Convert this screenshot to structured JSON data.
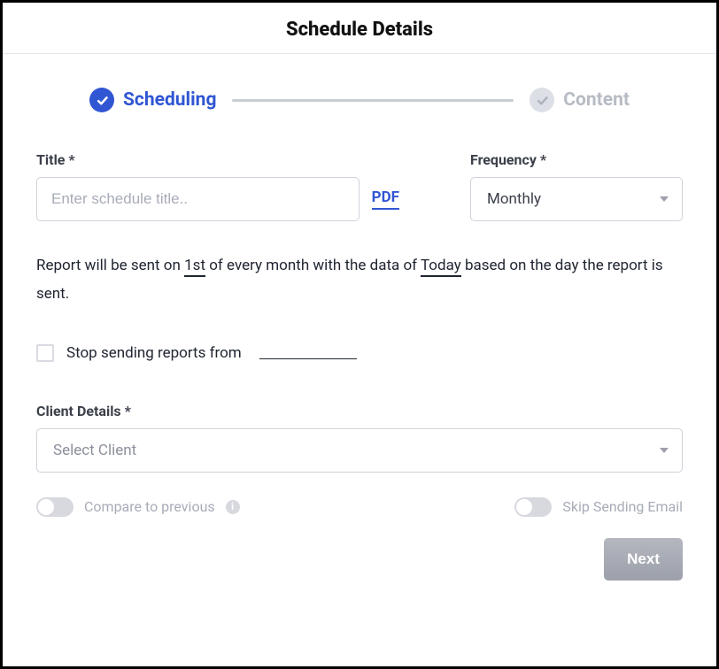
{
  "header": {
    "title": "Schedule Details"
  },
  "stepper": {
    "steps": [
      {
        "label": "Scheduling",
        "active": true
      },
      {
        "label": "Content",
        "active": false
      }
    ]
  },
  "form": {
    "title_label": "Title *",
    "title_placeholder": "Enter schedule title..",
    "title_value": "",
    "pdf_label": "PDF",
    "frequency_label": "Frequency *",
    "frequency_value": "Monthly",
    "sentence_part1": "Report will be sent on ",
    "sentence_value1": "1st",
    "sentence_part2": " of every month with the data of ",
    "sentence_value2": "Today",
    "sentence_part3": " based on the day the report is sent.",
    "stop_label": "Stop sending reports from",
    "stop_checked": false,
    "stop_date": "",
    "client_label": "Client Details *",
    "client_value": "Select Client"
  },
  "toggles": {
    "compare_label": "Compare to previous",
    "compare_on": false,
    "skip_label": "Skip Sending Email",
    "skip_on": false
  },
  "footer": {
    "next_label": "Next"
  }
}
